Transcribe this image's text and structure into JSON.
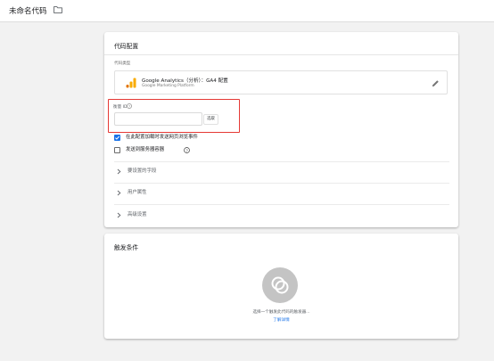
{
  "window": {
    "tag_title": "未命名代码",
    "folder_icon": "folder-outline-icon"
  },
  "config_card": {
    "header": "代码配置",
    "tag_type_label": "代码类型",
    "tag_type": {
      "icon": "google-analytics-bars-icon",
      "name": "Google Analytics（分析）：GA4 配置",
      "provider": "Google Marketing Platform",
      "edit_icon": "pencil-icon"
    },
    "measurement_id": {
      "label": "衡量 ID",
      "help_icon": "help-circle-icon",
      "value": "",
      "variable_button_label": "选取"
    },
    "checkboxes": [
      {
        "label": "在此配置加载时发送网页浏览事件",
        "checked": true
      },
      {
        "label": "发送到服务器容器",
        "checked": false,
        "help_icon": "help-circle-icon"
      }
    ],
    "expandable_sections": [
      {
        "label": "要设置的字段",
        "icon": "chevron-right-icon"
      },
      {
        "label": "用户属性",
        "icon": "chevron-right-icon"
      },
      {
        "label": "高级设置",
        "icon": "chevron-right-icon"
      }
    ]
  },
  "trigger_card": {
    "header": "触发条件",
    "empty_icon": "trigger-placeholder-circle-icon",
    "hint": "选择一个触发此代码的触发器...",
    "learn_more_link": "了解详情"
  },
  "colors": {
    "accent_blue": "#1a73e8",
    "highlight_red": "#e53935",
    "ga_orange": "#f9ab00",
    "ga_dark_orange": "#e37400",
    "placeholder_gray": "#c4c4c4",
    "background": "#f2f2f2"
  }
}
